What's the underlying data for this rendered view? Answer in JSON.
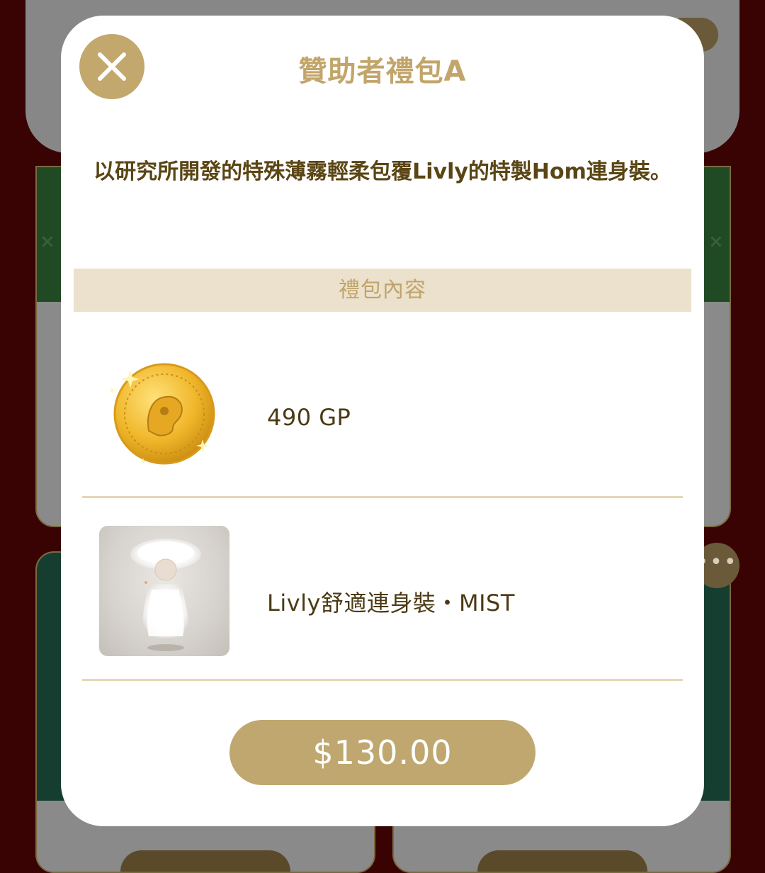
{
  "modal": {
    "title": "贊助者禮包A",
    "description": "以研究所開發的特殊薄霧輕柔包覆Livly的特製Hom連身裝。",
    "section_header": "禮包內容",
    "items": [
      {
        "label": "490 GP",
        "icon": "gold-coin-icon"
      },
      {
        "label": "Livly舒適連身裝・MIST",
        "icon": "mist-outfit-thumbnail"
      }
    ],
    "price_button": "$130.00",
    "close_icon": "close-icon"
  },
  "colors": {
    "accent_gold": "#c2a86d",
    "title_gold": "#c2a56a",
    "section_bg": "#ece1cc",
    "text_brown": "#5a4514",
    "page_bg": "#3a0303"
  }
}
